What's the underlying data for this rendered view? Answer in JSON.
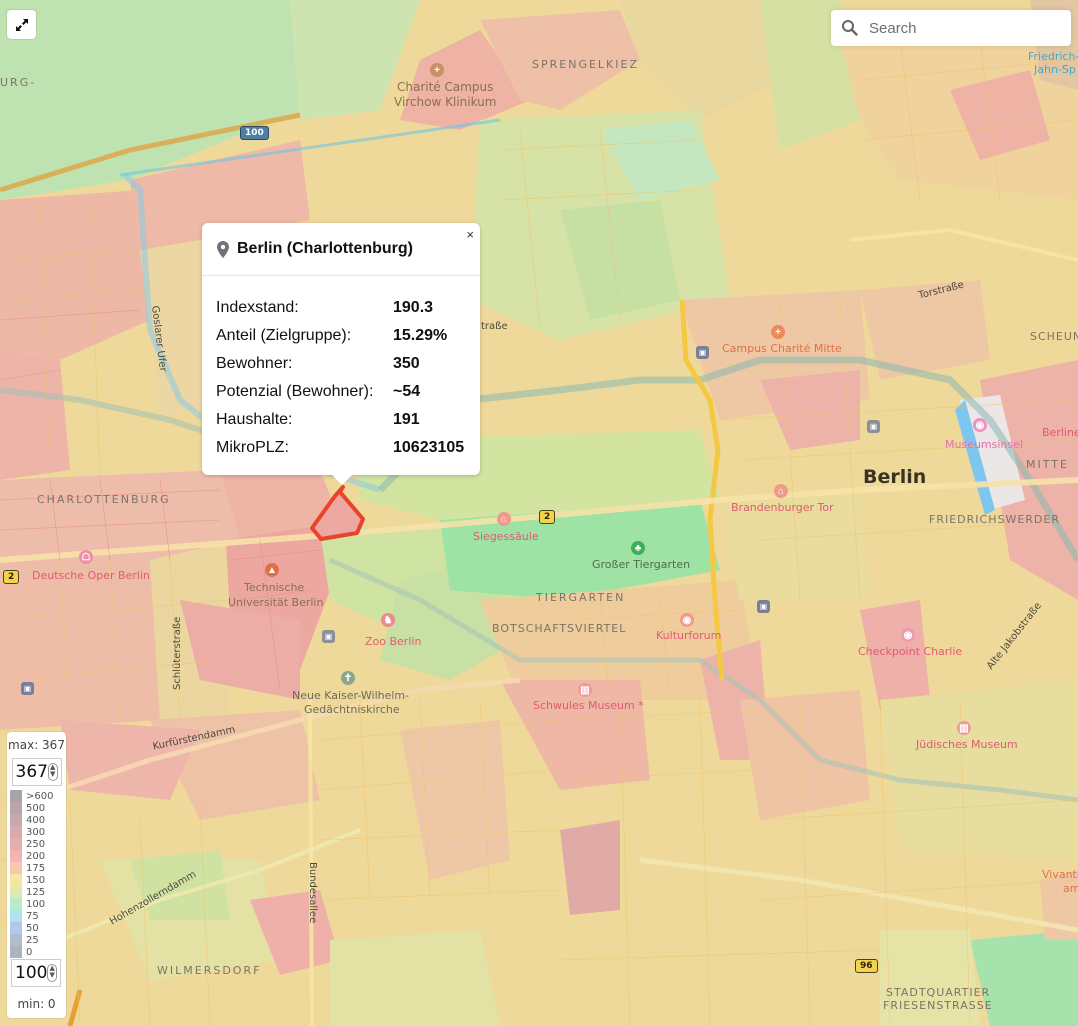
{
  "controls": {
    "fullscreen_icon": "expand-arrows-icon",
    "search": {
      "placeholder": "Search",
      "value": "",
      "icon": "search-icon"
    }
  },
  "popup": {
    "title": "Berlin (Charlottenburg)",
    "icon": "map-pin-icon",
    "close_label": "×",
    "rows": [
      {
        "label": "Indexstand:",
        "value": "190.3"
      },
      {
        "label": "Anteil (Zielgruppe):",
        "value": "15.29%"
      },
      {
        "label": "Bewohner:",
        "value": "350"
      },
      {
        "label": "Potenzial (Bewohner):",
        "value": "~54"
      },
      {
        "label": "Haushalte:",
        "value": "191"
      },
      {
        "label": "MikroPLZ:",
        "value": "10623105"
      }
    ]
  },
  "legend": {
    "max_label": "max: 367",
    "max_value": "367",
    "min_value": "100",
    "min_label": "min: 0",
    "steps": [
      {
        "label": ">600",
        "color": "#a7a3a8"
      },
      {
        "label": "500",
        "color": "#b8a6aa"
      },
      {
        "label": "400",
        "color": "#c9a9ad"
      },
      {
        "label": "300",
        "color": "#d9abad"
      },
      {
        "label": "250",
        "color": "#e2aeae"
      },
      {
        "label": "200",
        "color": "#f5b3b3"
      },
      {
        "label": "175",
        "color": "#f8c7b2"
      },
      {
        "label": "150",
        "color": "#fbe3a0"
      },
      {
        "label": "125",
        "color": "#dfeaae"
      },
      {
        "label": "100",
        "color": "#b6ecc7"
      },
      {
        "label": "75",
        "color": "#b2e1ee"
      },
      {
        "label": "50",
        "color": "#b0c9ea"
      },
      {
        "label": "25",
        "color": "#b0bdd0"
      },
      {
        "label": "0",
        "color": "#aeb2c0"
      }
    ]
  },
  "map": {
    "selected_outline_color": "#e8432c",
    "labels": {
      "sprengelkiez": "SPRENGELKIEZ",
      "charite_virchow_1": "Charité Campus",
      "charite_virchow_2": "Virchow Klinikum",
      "burg": "URG-",
      "friedrich_1": "Friedrich-",
      "friedrich_2": "Jahn-Sp",
      "torstrasse": "Torstraße",
      "scheun": "SCHEUN",
      "strasse": "traße",
      "campus_charite_mitte": "Campus Charité Mitte",
      "goslarer_ufer": "Goslarer Ufer",
      "museumsinsel": "Museumsinsel",
      "berline": "Berline",
      "mitte": "MITTE",
      "berlin": "Berlin",
      "friedrichswerder": "FRIEDRICHSWERDER",
      "brandenburger_tor": "Brandenburger Tor",
      "charlottenburg": "CHARLOTTENBURG",
      "deutsche_oper": "Deutsche Oper Berlin",
      "tu_1": "Technische",
      "tu_2": "Universität Berlin",
      "siegessaeule": "Siegessäule",
      "grosser_tiergarten": "Großer Tiergarten",
      "tiergarten": "TIERGARTEN",
      "botschaftsviertel": "BOTSCHAFTSVIERTEL",
      "kulturforum": "Kulturforum",
      "zoo_berlin": "Zoo Berlin",
      "schlueterstrasse": "Schlüterstraße",
      "gedaechtnis_1": "Neue Kaiser-Wilhelm-",
      "gedaechtnis_2": "Gedächtniskirche",
      "kurfuerstendamm": "Kurfürstendamm",
      "schwules_museum": "Schwules Museum *",
      "checkpoint_charlie": "Checkpoint Charlie",
      "alte_jakobstrasse": "Alte Jakobstraße",
      "juedisches_museum": "Jüdisches Museum",
      "hohenzollerndamm": "Hohenzollerndamm",
      "bundesallee": "Bundesallee",
      "wilmersdorf": "WILMERSDORF",
      "vivante_1": "Vivante",
      "vivante_2": "am",
      "stadtquartier_1": "STADTQUARTIER",
      "stadtquartier_2": "FRIESENSTRASSE"
    },
    "shields": {
      "a100": "100",
      "b2_west": "2",
      "b2_center": "2",
      "b96": "96"
    }
  }
}
